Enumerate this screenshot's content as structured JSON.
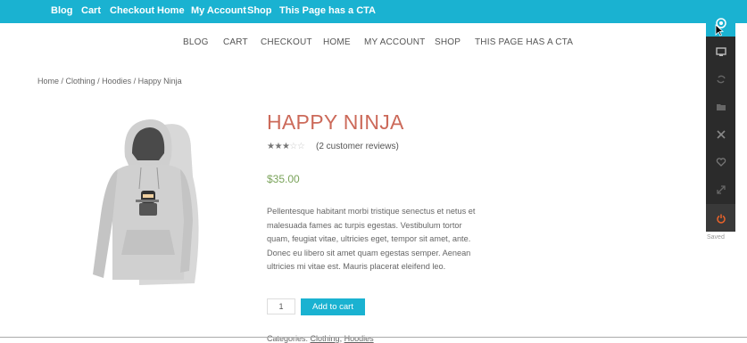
{
  "top_bar": {
    "items": [
      "Blog",
      "Cart",
      "Checkout",
      "Home",
      "My Account",
      "Shop",
      "This Page has a CTA"
    ]
  },
  "main_nav": {
    "items": [
      "BLOG",
      "CART",
      "CHECKOUT",
      "HOME",
      "MY ACCOUNT",
      "SHOP",
      "THIS PAGE HAS A CTA"
    ]
  },
  "breadcrumb": {
    "items": [
      "Home",
      "Clothing",
      "Hoodies",
      "Happy Ninja"
    ],
    "separator": " / "
  },
  "product": {
    "title": "HAPPY NINJA",
    "rating_stars": 3,
    "rating_max": 5,
    "reviews_text": "(2 customer reviews)",
    "price": "$35.00",
    "description": "Pellentesque habitant morbi tristique senectus et netus et malesuada fames ac turpis egestas. Vestibulum tortor quam, feugiat vitae, ultricies eget, tempor sit amet, ante. Donec eu libero sit amet quam egestas semper. Aenean ultricies mi vitae est. Mauris placerat eleifend leo.",
    "quantity": "1",
    "add_to_cart_label": "Add to cart",
    "categories_label": "Categories:",
    "categories": [
      "Clothing",
      "Hoodies"
    ]
  },
  "side_panel": {
    "buttons": [
      "customize-icon",
      "monitor-icon",
      "refresh-icon",
      "folder-icon",
      "tools-icon",
      "heart-icon",
      "expand-icon",
      "power-icon"
    ],
    "status": "Saved"
  },
  "colors": {
    "accent": "#1ab2d1",
    "title": "#cc6a5a",
    "price": "#7aa35a",
    "panel": "#2b2b2b"
  }
}
